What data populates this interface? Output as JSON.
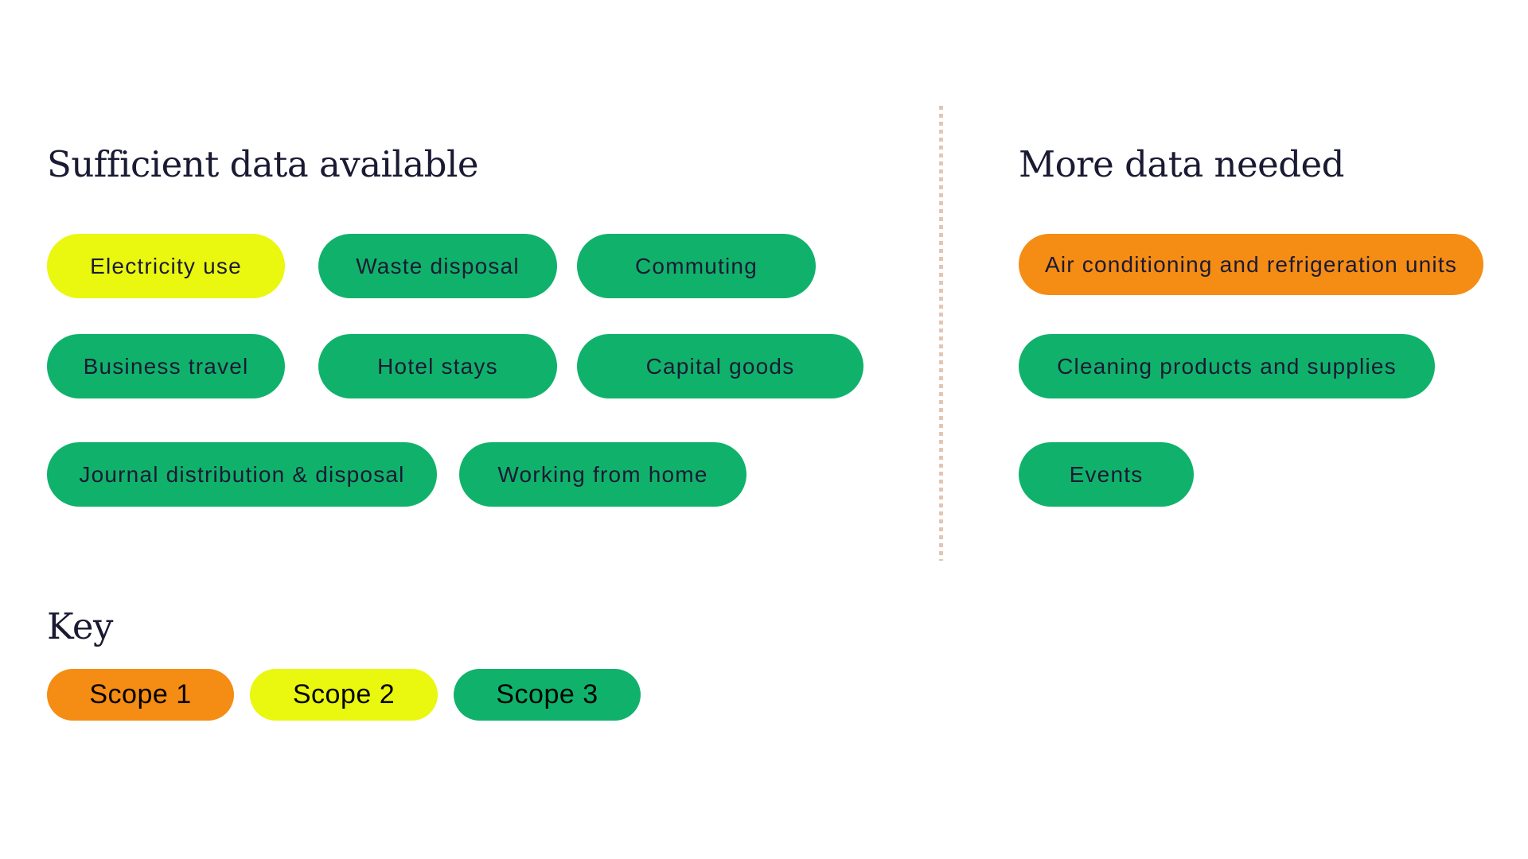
{
  "colors": {
    "scope1": "#f58c14",
    "scope2": "#eaf70f",
    "scope3": "#10b26b",
    "text": "#1a1a33",
    "divider": "#e2c7b4"
  },
  "sufficient": {
    "title": "Sufficient data available",
    "items": [
      {
        "label": "Electricity use",
        "scope": 2
      },
      {
        "label": "Waste disposal",
        "scope": 3
      },
      {
        "label": "Commuting",
        "scope": 3
      },
      {
        "label": "Business travel",
        "scope": 3
      },
      {
        "label": "Hotel stays",
        "scope": 3
      },
      {
        "label": "Capital goods",
        "scope": 3
      },
      {
        "label": "Journal distribution & disposal",
        "scope": 3
      },
      {
        "label": "Working from home",
        "scope": 3
      }
    ]
  },
  "needed": {
    "title": "More data needed",
    "items": [
      {
        "label": "Air conditioning and refrigeration units",
        "scope": 1
      },
      {
        "label": "Cleaning products and supplies",
        "scope": 3
      },
      {
        "label": "Events",
        "scope": 3
      }
    ]
  },
  "key": {
    "title": "Key",
    "items": [
      {
        "label": "Scope 1",
        "scope": 1
      },
      {
        "label": "Scope 2",
        "scope": 2
      },
      {
        "label": "Scope 3",
        "scope": 3
      }
    ]
  }
}
